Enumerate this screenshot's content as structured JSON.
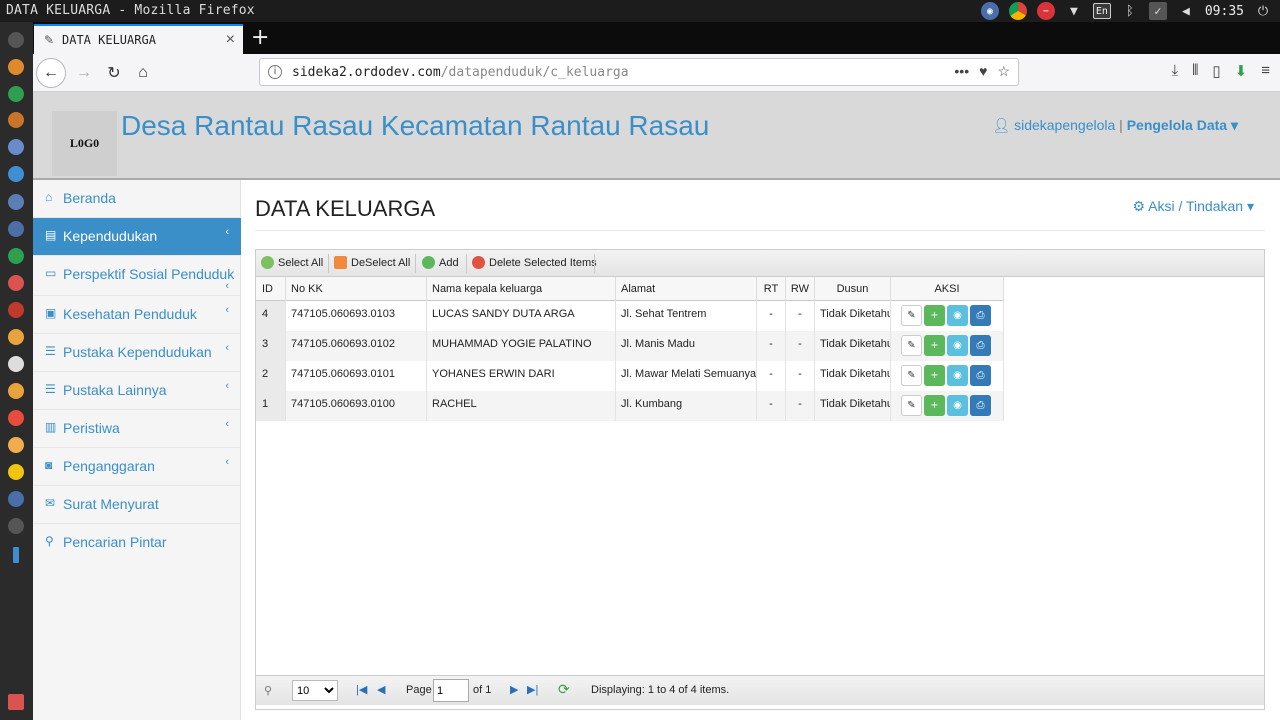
{
  "os": {
    "window_title": "DATA KELUARGA - Mozilla Firefox",
    "lang": "En",
    "clock": "09:35"
  },
  "browser": {
    "tab_title": "DATA KELUARGA",
    "url_host": "sideka2.ordodev.com",
    "url_path": "/datapenduduk/c_keluarga"
  },
  "header": {
    "logo": "L0G0",
    "site_title": "Desa Rantau Rasau Kecamatan Rantau Rasau",
    "user": "sidekapengelola",
    "separator": "|",
    "role": "Pengelola Data"
  },
  "sidebar": {
    "items": [
      {
        "label": "Beranda",
        "icon": "home-icon"
      },
      {
        "label": "Kependudukan",
        "icon": "book-icon"
      },
      {
        "label": "Perspektif Sosial Penduduk",
        "icon": "monitor-icon"
      },
      {
        "label": "Kesehatan Penduduk",
        "icon": "medkit-icon"
      },
      {
        "label": "Pustaka Kependudukan",
        "icon": "list-icon"
      },
      {
        "label": "Pustaka Lainnya",
        "icon": "list-icon"
      },
      {
        "label": "Peristiwa",
        "icon": "newspaper-icon"
      },
      {
        "label": "Penganggaran",
        "icon": "money-icon"
      },
      {
        "label": "Surat Menyurat",
        "icon": "envelope-icon"
      },
      {
        "label": "Pencarian Pintar",
        "icon": "search-icon"
      }
    ]
  },
  "main": {
    "title": "DATA KELUARGA",
    "action_menu": "Aksi / Tindakan"
  },
  "grid": {
    "toolbar": {
      "select_all": "Select All",
      "deselect_all": "DeSelect All",
      "add": "Add",
      "delete_selected": "Delete Selected Items"
    },
    "columns": [
      "ID",
      "No KK",
      "Nama kepala keluarga",
      "Alamat",
      "RT",
      "RW",
      "Dusun",
      "AKSI"
    ],
    "rows": [
      {
        "id": "4",
        "no_kk": "747105.060693.0103",
        "nama": "LUCAS SANDY DUTA ARGA",
        "alamat": "Jl. Sehat Tentrem",
        "rt": "-",
        "rw": "-",
        "dusun": "Tidak Diketahui"
      },
      {
        "id": "3",
        "no_kk": "747105.060693.0102",
        "nama": "MUHAMMAD YOGIE PALATINO",
        "alamat": "Jl. Manis Madu",
        "rt": "-",
        "rw": "-",
        "dusun": "Tidak Diketahui"
      },
      {
        "id": "2",
        "no_kk": "747105.060693.0101",
        "nama": "YOHANES ERWIN DARI",
        "alamat": "Jl. Mawar Melati Semuanya Indah",
        "rt": "-",
        "rw": "-",
        "dusun": "Tidak Diketahui"
      },
      {
        "id": "1",
        "no_kk": "747105.060693.0100",
        "nama": "RACHEL",
        "alamat": "Jl. Kumbang",
        "rt": "-",
        "rw": "-",
        "dusun": "Tidak Diketahui"
      }
    ],
    "pager": {
      "page_size": "10",
      "page_label": "Page",
      "page_value": "1",
      "of_label": "of 1",
      "displaying": "Displaying: 1 to 4 of 4 items."
    }
  },
  "colors": {
    "accent": "#3a8fc9",
    "header_bg": "#d9d9d9",
    "sidebar_active": "#3a8fc9",
    "btn_add": "#5cb85c",
    "btn_view": "#5bc0de",
    "btn_print": "#337ab7"
  }
}
